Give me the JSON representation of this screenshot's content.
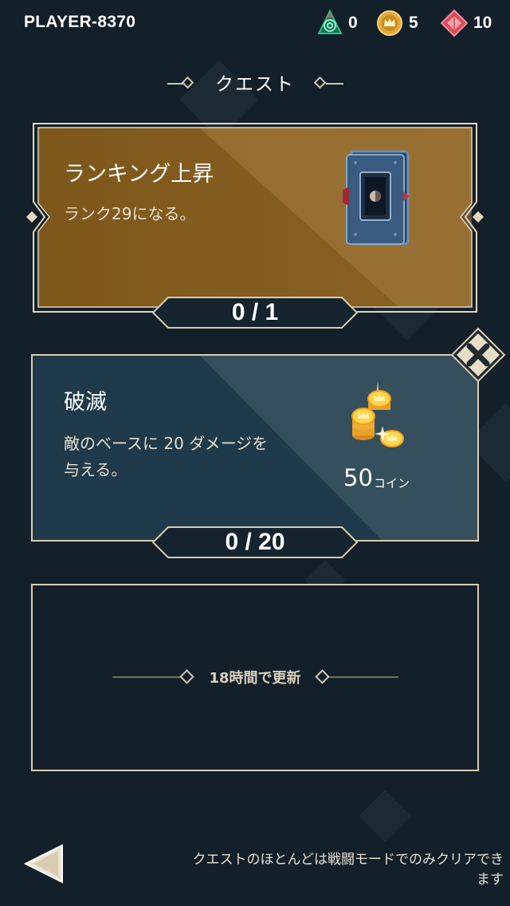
{
  "header": {
    "player_name": "PLAYER-8370",
    "resources": [
      {
        "icon": "green-swirl-icon",
        "value": "0",
        "color": "#1f9b6a"
      },
      {
        "icon": "crown-coin-icon",
        "value": "5",
        "color": "#e3a83a"
      },
      {
        "icon": "red-gem-icon",
        "value": "10",
        "color": "#d84b5c"
      }
    ]
  },
  "page": {
    "title": "クエスト"
  },
  "quests": [
    {
      "title": "ランキング上昇",
      "description": "ランク29になる。",
      "reward_icon": "card-deck-icon",
      "progress": "0 / 1",
      "accent": "#7a551c"
    },
    {
      "title": "破滅",
      "description_line1": "敵のベースに 20 ダメージを",
      "description_line2": "与える。",
      "reward_icon": "gold-coins-icon",
      "reward_amount": "50",
      "reward_unit": "コイン",
      "progress": "0 / 20",
      "accent": "#1f3a4a"
    }
  ],
  "empty_slot": {
    "refresh_text": "18時間で更新"
  },
  "footer": {
    "hint_line1": "クエストのほとんどは戦闘モードでのみクリアでき",
    "hint_line2": "ます"
  }
}
